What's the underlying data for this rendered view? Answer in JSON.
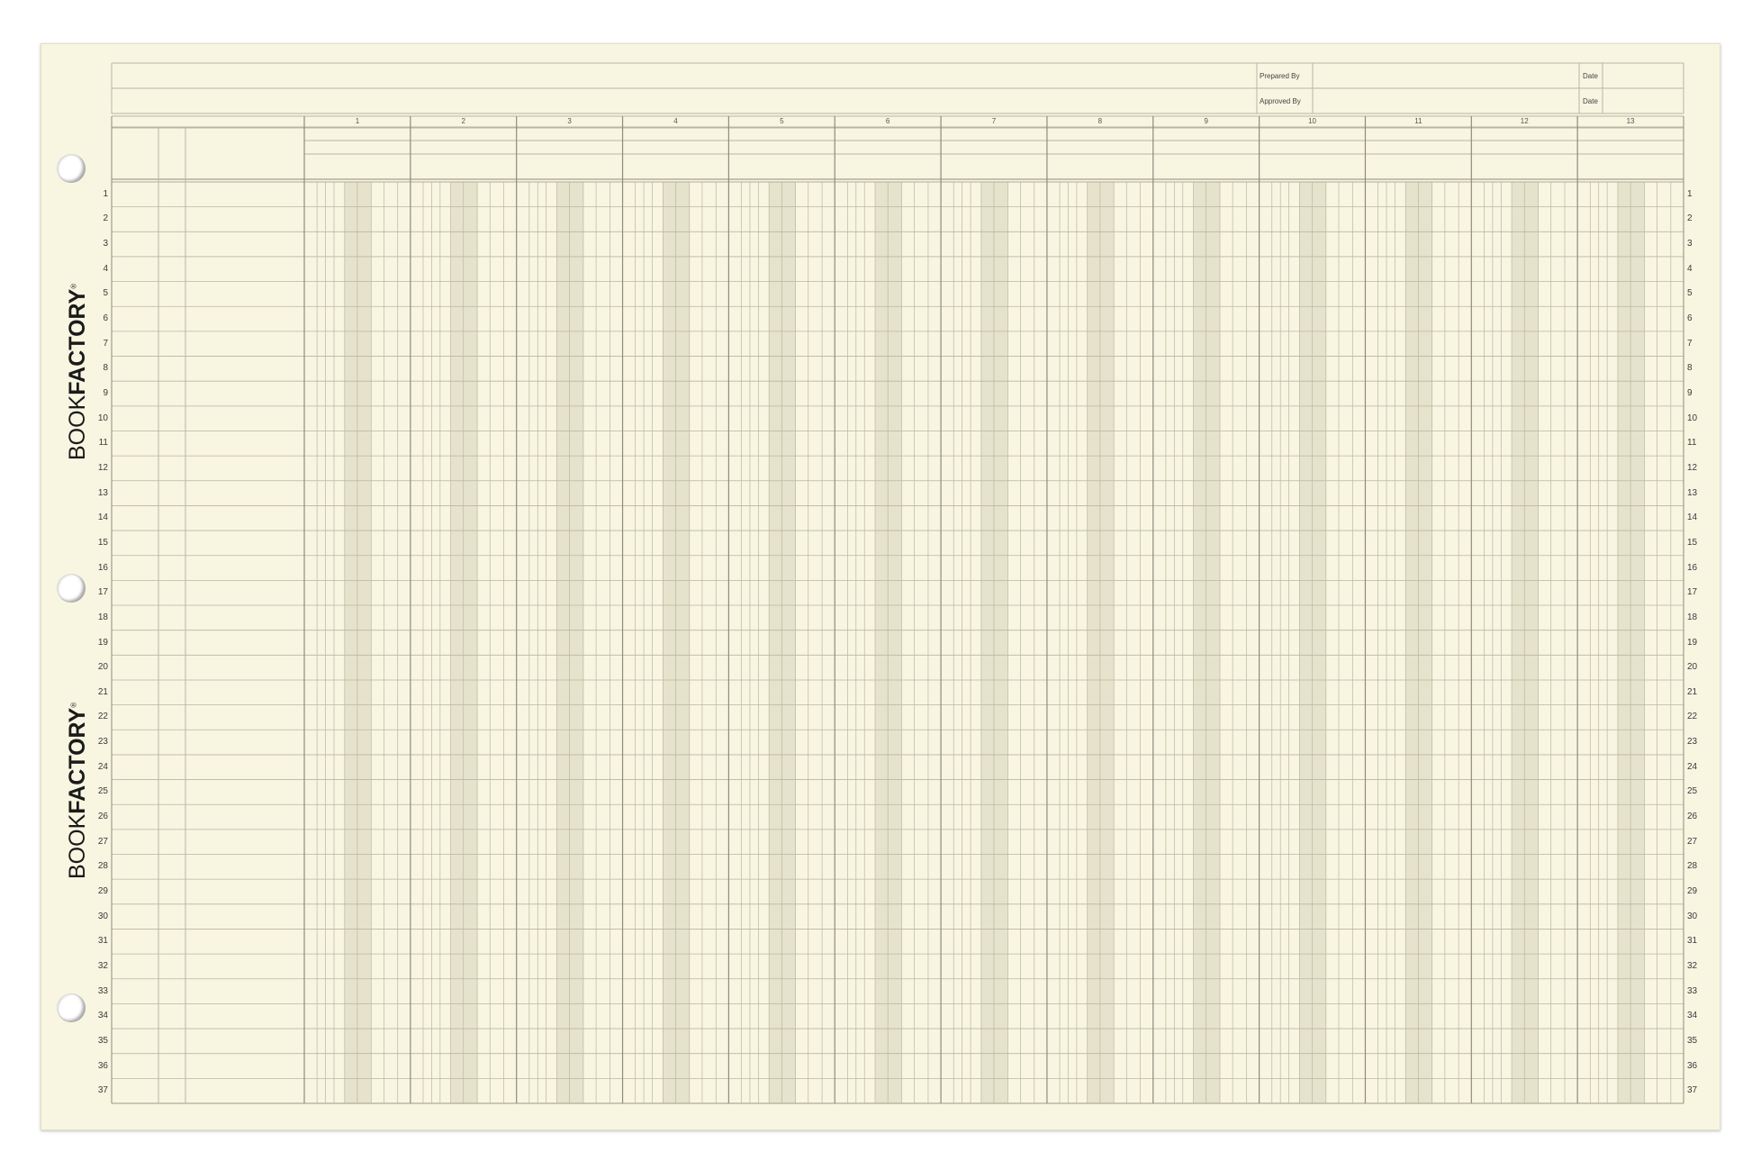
{
  "brand": {
    "light_text": "BOOK",
    "bold_text": "FACTORY",
    "registered": "®"
  },
  "header": {
    "prepared_by_label": "Prepared By",
    "approved_by_label": "Approved By",
    "date_label_1": "Date",
    "date_label_2": "Date"
  },
  "columns": [
    "1",
    "2",
    "3",
    "4",
    "5",
    "6",
    "7",
    "8",
    "9",
    "10",
    "11",
    "12",
    "13"
  ],
  "rows": [
    "1",
    "2",
    "3",
    "4",
    "5",
    "6",
    "7",
    "8",
    "9",
    "10",
    "11",
    "12",
    "13",
    "14",
    "15",
    "16",
    "17",
    "18",
    "19",
    "20",
    "21",
    "22",
    "23",
    "24",
    "25",
    "26",
    "27",
    "28",
    "29",
    "30",
    "31",
    "32",
    "33",
    "34",
    "35",
    "36",
    "37"
  ],
  "colors": {
    "paper": "#f8f5e1",
    "line": "#b9b6a2",
    "heavy_line": "#8e8c7c",
    "shade": "#e6e3cc"
  }
}
